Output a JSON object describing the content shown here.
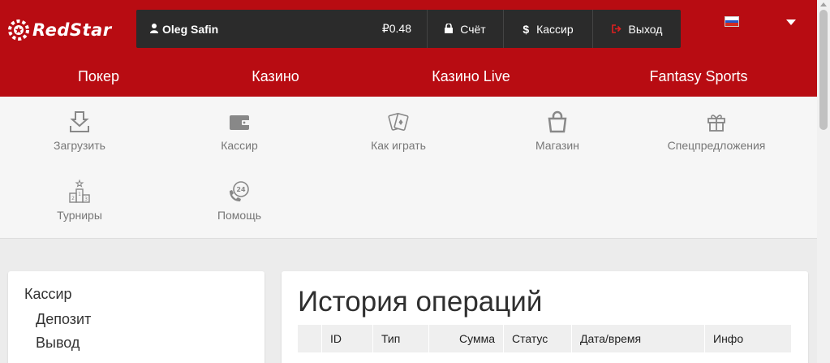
{
  "brand": {
    "name": "RedStar"
  },
  "user": {
    "name": "Oleg Safin",
    "balance": "₽0.48"
  },
  "actions": {
    "account": "Счёт",
    "cashier": "Кассир",
    "exit": "Выход"
  },
  "nav": [
    "Покер",
    "Казино",
    "Казино Live",
    "Fantasy Sports"
  ],
  "iconmenu": {
    "download": "Загрузить",
    "cashier": "Кассир",
    "howto": "Как играть",
    "shop": "Магазин",
    "promo": "Спецпредложения",
    "tournaments": "Турниры",
    "help": "Помощь"
  },
  "sidebar": {
    "head": "Кассир",
    "deposit": "Депозит",
    "withdraw": "Вывод"
  },
  "main": {
    "title": "История операций",
    "columns": [
      "ID",
      "Тип",
      "Сумма",
      "Статус",
      "Дата/время",
      "Инфо"
    ]
  },
  "colors": {
    "brand_red": "#b80c12",
    "bar_dark": "#2b2b2b",
    "exit_red": "#e02020"
  }
}
